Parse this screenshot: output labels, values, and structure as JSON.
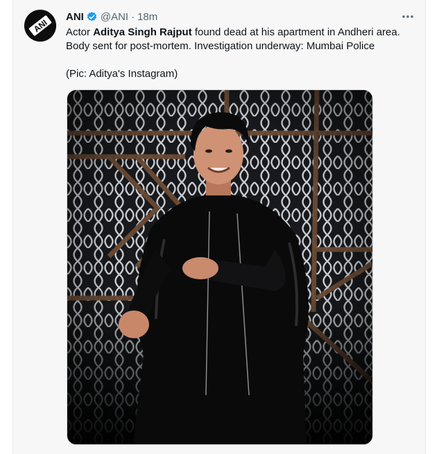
{
  "tweet": {
    "author_name": "ANI",
    "author_handle": "@ANI",
    "separator": "·",
    "timestamp": "18m",
    "verified": true,
    "text_line1_pre": "Actor ",
    "text_line1_bold": "Aditya Singh Rajput",
    "text_line1_post": " found dead at his apartment in Andheri area.",
    "text_line2": "Body sent for post-mortem. Investigation underway: Mumbai Police",
    "text_line3": "(Pic: Aditya's Instagram)",
    "avatar_label": "ANI"
  },
  "icons": {
    "verified": "verified-badge-icon",
    "more": "more-options-icon"
  },
  "colors": {
    "verified_blue": "#1d9bf0",
    "muted_text": "#536471",
    "primary_text": "#0f1419"
  }
}
